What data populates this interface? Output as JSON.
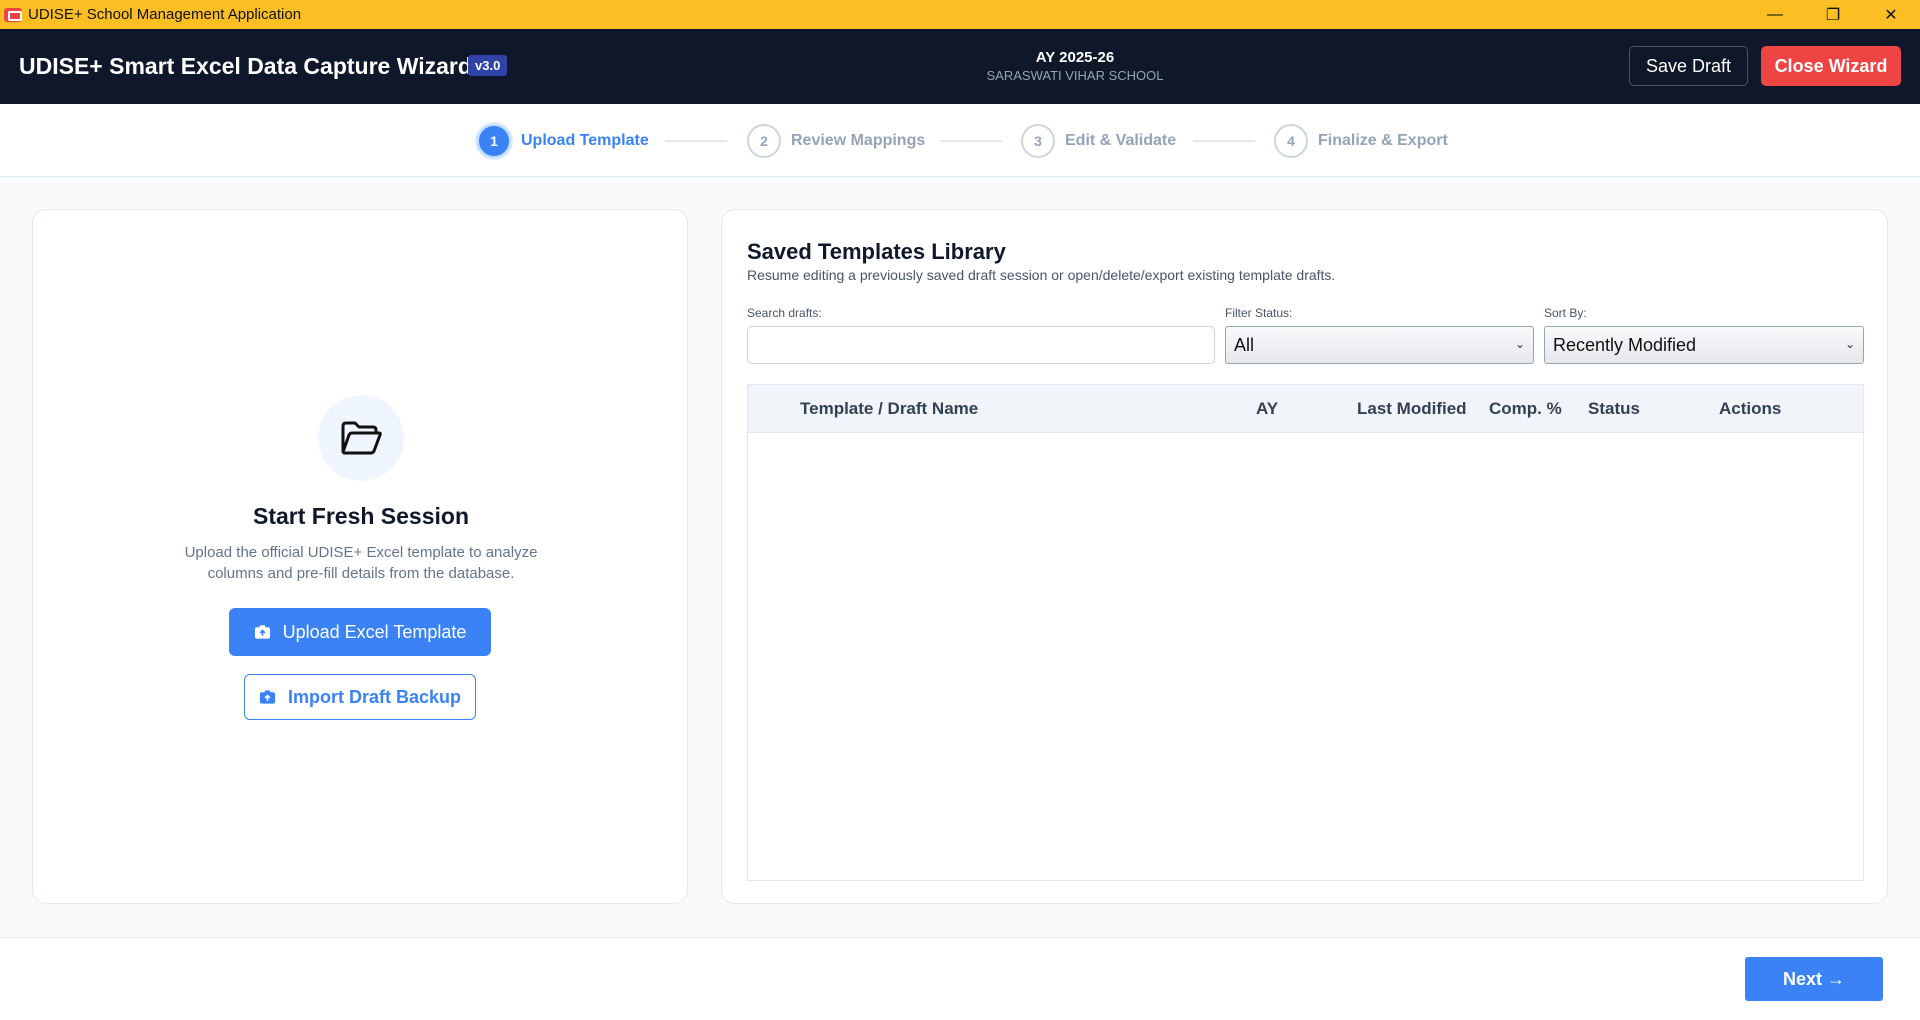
{
  "window": {
    "title": "UDISE+ School Management Application",
    "controls": {
      "minimize": "—",
      "restore": "❐",
      "close": "✕"
    }
  },
  "header": {
    "title": "UDISE+ Smart Excel Data Capture Wizard",
    "version": "v3.0",
    "ay": "AY 2025-26",
    "school": "SARASWATI VIHAR SCHOOL",
    "save_draft": "Save Draft",
    "close_wizard": "Close Wizard",
    "close_color": "#ef4444"
  },
  "stepper": {
    "steps": [
      {
        "number": "1",
        "label": "Upload Template",
        "active": true
      },
      {
        "number": "2",
        "label": "Review Mappings",
        "active": false
      },
      {
        "number": "3",
        "label": "Edit & Validate",
        "active": false
      },
      {
        "number": "4",
        "label": "Finalize & Export",
        "active": false
      }
    ],
    "accent": "#3b82f6"
  },
  "fresh": {
    "icon": "folder-open-icon",
    "title": "Start Fresh Session",
    "description": "Upload the official UDISE+ Excel template to analyze columns and pre-fill details from the database.",
    "upload_button": "Upload Excel Template",
    "import_button": "Import Draft Backup"
  },
  "library": {
    "title": "Saved Templates Library",
    "description": "Resume editing a previously saved draft session or open/delete/export existing template drafts.",
    "search_label": "Search drafts:",
    "search_value": "",
    "search_placeholder": "",
    "filter_label": "Filter Status:",
    "filter_value": "All",
    "sort_label": "Sort By:",
    "sort_value": "Recently Modified",
    "columns": [
      "Template / Draft Name",
      "AY",
      "Last Modified",
      "Comp. %",
      "Status",
      "Actions"
    ],
    "rows": []
  },
  "footer": {
    "next": "Next →"
  }
}
